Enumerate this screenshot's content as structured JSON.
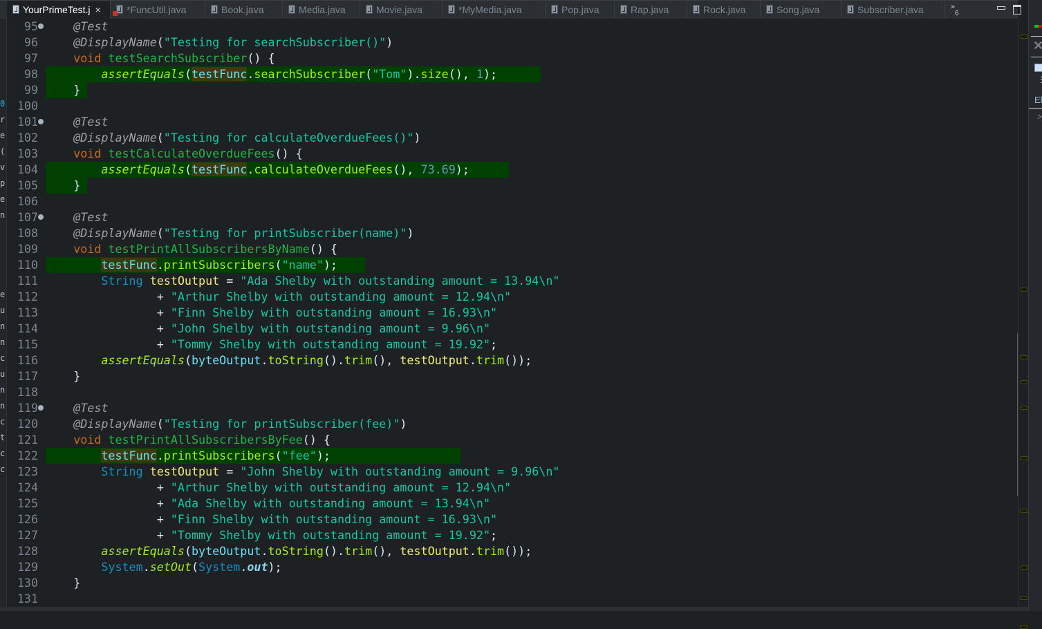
{
  "tabs": [
    {
      "label": "YourPrimeTest.j",
      "active": true,
      "closable": true
    },
    {
      "label": "*FuncUtil.java",
      "error": true
    },
    {
      "label": "Book.java"
    },
    {
      "label": "Media.java"
    },
    {
      "label": "Movie.java"
    },
    {
      "label": "*MyMedia.java"
    },
    {
      "label": "Pop.java"
    },
    {
      "label": "Rap.java"
    },
    {
      "label": "Rock.java"
    },
    {
      "label": "Song.java"
    },
    {
      "label": "Subscriber.java"
    }
  ],
  "tab_overflow": {
    "icon": "chevron-double-right-icon",
    "count": "6"
  },
  "window_controls": {
    "minimize": "minimize-icon",
    "maximize": "maximize-icon"
  },
  "close_glyph": "×",
  "left_strip_chars": [
    "0",
    "r",
    "e",
    "(",
    "v",
    "p",
    "e",
    "n",
    "",
    "",
    "",
    "",
    "e",
    "u",
    "n",
    "n",
    "c",
    "u",
    "n",
    "n",
    "c",
    "t",
    "c",
    "c"
  ],
  "right_panel": {
    "label": "El",
    "chevron": ">"
  },
  "colors": {
    "editor_bg": "#1e2124",
    "highlight_bg": "#004000",
    "occurrence_bg": "#3c3c10",
    "keyword": "#cc6c1d",
    "string": "#17c6a3"
  },
  "lines": [
    {
      "n": "95",
      "fold": true,
      "segs": [
        [
          "    ",
          ""
        ],
        [
          "@Test",
          "ann"
        ]
      ]
    },
    {
      "n": "96",
      "segs": [
        [
          "    ",
          ""
        ],
        [
          "@DisplayName",
          "ann"
        ],
        [
          "(",
          ""
        ],
        [
          "\"Testing for searchSubscriber()\"",
          "str"
        ],
        [
          ")",
          ""
        ]
      ]
    },
    {
      "n": "97",
      "segs": [
        [
          "    ",
          ""
        ],
        [
          "void",
          "kw"
        ],
        [
          " ",
          ""
        ],
        [
          "testSearchSubscriber",
          "meth"
        ],
        [
          "() {",
          ""
        ]
      ]
    },
    {
      "n": "98",
      "hl": true,
      "segs": [
        [
          "        ",
          ""
        ],
        [
          "assertEquals",
          "ital"
        ],
        [
          "(",
          ""
        ],
        [
          "testFunc",
          "fld occ"
        ],
        [
          ".",
          ""
        ],
        [
          "searchSubscriber",
          "call"
        ],
        [
          "(",
          ""
        ],
        [
          "\"Tom\"",
          "str"
        ],
        [
          ").",
          ""
        ],
        [
          "size",
          "call"
        ],
        [
          "(), ",
          ""
        ],
        [
          "1",
          "num"
        ],
        [
          ");",
          ""
        ]
      ]
    },
    {
      "n": "99",
      "hl": true,
      "segs": [
        [
          "    ",
          ""
        ],
        [
          "}",
          ""
        ]
      ]
    },
    {
      "n": "100",
      "segs": []
    },
    {
      "n": "101",
      "fold": true,
      "segs": [
        [
          "    ",
          ""
        ],
        [
          "@Test",
          "ann"
        ]
      ]
    },
    {
      "n": "102",
      "segs": [
        [
          "    ",
          ""
        ],
        [
          "@DisplayName",
          "ann"
        ],
        [
          "(",
          ""
        ],
        [
          "\"Testing for calculateOverdueFees()\"",
          "str"
        ],
        [
          ")",
          ""
        ]
      ]
    },
    {
      "n": "103",
      "segs": [
        [
          "    ",
          ""
        ],
        [
          "void",
          "kw"
        ],
        [
          " ",
          ""
        ],
        [
          "testCalculateOverdueFees",
          "meth"
        ],
        [
          "() {",
          ""
        ]
      ]
    },
    {
      "n": "104",
      "hl": true,
      "segs": [
        [
          "        ",
          ""
        ],
        [
          "assertEquals",
          "ital"
        ],
        [
          "(",
          ""
        ],
        [
          "testFunc",
          "fld occ"
        ],
        [
          ".",
          ""
        ],
        [
          "calculateOverdueFees",
          "call"
        ],
        [
          "(), ",
          ""
        ],
        [
          "73.69",
          "num"
        ],
        [
          ");",
          ""
        ]
      ]
    },
    {
      "n": "105",
      "hl": true,
      "segs": [
        [
          "    ",
          ""
        ],
        [
          "}",
          ""
        ]
      ]
    },
    {
      "n": "106",
      "segs": []
    },
    {
      "n": "107",
      "fold": true,
      "segs": [
        [
          "    ",
          ""
        ],
        [
          "@Test",
          "ann"
        ]
      ]
    },
    {
      "n": "108",
      "segs": [
        [
          "    ",
          ""
        ],
        [
          "@DisplayName",
          "ann"
        ],
        [
          "(",
          ""
        ],
        [
          "\"Testing for printSubscriber(name)\"",
          "str"
        ],
        [
          ")",
          ""
        ]
      ]
    },
    {
      "n": "109",
      "segs": [
        [
          "    ",
          ""
        ],
        [
          "void",
          "kw"
        ],
        [
          " ",
          ""
        ],
        [
          "testPrintAllSubscribersByName",
          "meth"
        ],
        [
          "() {",
          ""
        ]
      ]
    },
    {
      "n": "110",
      "hl": true,
      "segs": [
        [
          "        ",
          ""
        ],
        [
          "testFunc",
          "fld occ"
        ],
        [
          ".",
          ""
        ],
        [
          "printSubscribers",
          "call"
        ],
        [
          "(",
          ""
        ],
        [
          "\"name\"",
          "str"
        ],
        [
          ");",
          ""
        ]
      ]
    },
    {
      "n": "111",
      "segs": [
        [
          "        ",
          ""
        ],
        [
          "String",
          "typ"
        ],
        [
          " ",
          ""
        ],
        [
          "testOutput",
          "var"
        ],
        [
          " = ",
          ""
        ],
        [
          "\"Ada Shelby with outstanding amount = 13.94\\n\"",
          "str"
        ]
      ]
    },
    {
      "n": "112",
      "segs": [
        [
          "                + ",
          ""
        ],
        [
          "\"Arthur Shelby with outstanding amount = 12.94\\n\"",
          "str"
        ]
      ]
    },
    {
      "n": "113",
      "segs": [
        [
          "                + ",
          ""
        ],
        [
          "\"Finn Shelby with outstanding amount = 16.93\\n\"",
          "str"
        ]
      ]
    },
    {
      "n": "114",
      "segs": [
        [
          "                + ",
          ""
        ],
        [
          "\"John Shelby with outstanding amount = 9.96\\n\"",
          "str"
        ]
      ]
    },
    {
      "n": "115",
      "segs": [
        [
          "                + ",
          ""
        ],
        [
          "\"Tommy Shelby with outstanding amount = 19.92\"",
          "str"
        ],
        [
          ";",
          ""
        ]
      ]
    },
    {
      "n": "116",
      "segs": [
        [
          "        ",
          ""
        ],
        [
          "assertEquals",
          "ital"
        ],
        [
          "(",
          ""
        ],
        [
          "byteOutput",
          "fld"
        ],
        [
          ".",
          ""
        ],
        [
          "toString",
          "call"
        ],
        [
          "().",
          ""
        ],
        [
          "trim",
          "call"
        ],
        [
          "(), ",
          ""
        ],
        [
          "testOutput",
          "var"
        ],
        [
          ".",
          ""
        ],
        [
          "trim",
          "call"
        ],
        [
          "());",
          ""
        ]
      ]
    },
    {
      "n": "117",
      "segs": [
        [
          "    ",
          ""
        ],
        [
          "}",
          ""
        ]
      ]
    },
    {
      "n": "118",
      "segs": []
    },
    {
      "n": "119",
      "fold": true,
      "segs": [
        [
          "    ",
          ""
        ],
        [
          "@Test",
          "ann"
        ]
      ]
    },
    {
      "n": "120",
      "segs": [
        [
          "    ",
          ""
        ],
        [
          "@DisplayName",
          "ann"
        ],
        [
          "(",
          ""
        ],
        [
          "\"Testing for printSubscriber(fee)\"",
          "str"
        ],
        [
          ")",
          ""
        ]
      ]
    },
    {
      "n": "121",
      "segs": [
        [
          "    ",
          ""
        ],
        [
          "void",
          "kw"
        ],
        [
          " ",
          ""
        ],
        [
          "testPrintAllSubscribersByFee",
          "meth"
        ],
        [
          "() {",
          ""
        ]
      ]
    },
    {
      "n": "122",
      "hl": true,
      "segs": [
        [
          "        ",
          ""
        ],
        [
          "testFunc",
          "fld occ"
        ],
        [
          ".",
          ""
        ],
        [
          "printSubscribers",
          "call"
        ],
        [
          "(",
          ""
        ],
        [
          "\"fee\"",
          "str"
        ],
        [
          ");",
          ""
        ]
      ]
    },
    {
      "n": "123",
      "segs": [
        [
          "        ",
          ""
        ],
        [
          "String",
          "typ"
        ],
        [
          " ",
          ""
        ],
        [
          "testOutput",
          "var"
        ],
        [
          " = ",
          ""
        ],
        [
          "\"John Shelby with outstanding amount = 9.96\\n\"",
          "str"
        ]
      ]
    },
    {
      "n": "124",
      "segs": [
        [
          "                + ",
          ""
        ],
        [
          "\"Arthur Shelby with outstanding amount = 12.94\\n\"",
          "str"
        ]
      ]
    },
    {
      "n": "125",
      "segs": [
        [
          "                + ",
          ""
        ],
        [
          "\"Ada Shelby with outstanding amount = 13.94\\n\"",
          "str"
        ]
      ]
    },
    {
      "n": "126",
      "segs": [
        [
          "                + ",
          ""
        ],
        [
          "\"Finn Shelby with outstanding amount = 16.93\\n\"",
          "str"
        ]
      ]
    },
    {
      "n": "127",
      "segs": [
        [
          "                + ",
          ""
        ],
        [
          "\"Tommy Shelby with outstanding amount = 19.92\"",
          "str"
        ],
        [
          ";",
          ""
        ]
      ]
    },
    {
      "n": "128",
      "segs": [
        [
          "        ",
          ""
        ],
        [
          "assertEquals",
          "ital"
        ],
        [
          "(",
          ""
        ],
        [
          "byteOutput",
          "fld"
        ],
        [
          ".",
          ""
        ],
        [
          "toString",
          "call"
        ],
        [
          "().",
          ""
        ],
        [
          "trim",
          "call"
        ],
        [
          "(), ",
          ""
        ],
        [
          "testOutput",
          "var"
        ],
        [
          ".",
          ""
        ],
        [
          "trim",
          "call"
        ],
        [
          "());",
          ""
        ]
      ]
    },
    {
      "n": "129",
      "segs": [
        [
          "        ",
          ""
        ],
        [
          "System",
          "typ"
        ],
        [
          ".",
          ""
        ],
        [
          "setOut",
          "ital"
        ],
        [
          "(",
          ""
        ],
        [
          "System",
          "typ"
        ],
        [
          ".",
          ""
        ],
        [
          "out",
          "sfld"
        ],
        [
          ");",
          ""
        ]
      ]
    },
    {
      "n": "130",
      "segs": [
        [
          "    ",
          ""
        ],
        [
          "}",
          ""
        ]
      ]
    },
    {
      "n": "131",
      "segs": []
    }
  ]
}
